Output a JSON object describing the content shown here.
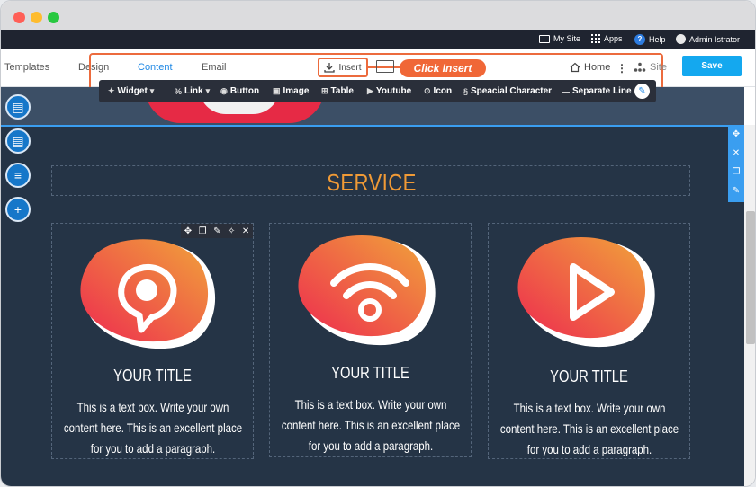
{
  "admin_bar": {
    "my_site": "My Site",
    "apps": "Apps",
    "help": "Help",
    "user": "Admin Istrator"
  },
  "nav": {
    "tabs": [
      "Templates",
      "Design",
      "Content",
      "Email"
    ],
    "active_tab": "Content",
    "insert": "Insert",
    "callout": "Click Insert",
    "home": "Home",
    "site": "Site",
    "save": "Save"
  },
  "insert_bar": {
    "widget": "Widget",
    "link": "Link",
    "button": "Button",
    "image": "Image",
    "table": "Table",
    "youtube": "Youtube",
    "icon": "Icon",
    "special_character": "Speacial Character",
    "separate_line": "Separate Line"
  },
  "section": {
    "title": "SERVICE",
    "cards": [
      {
        "icon": "location-pin-icon",
        "title": "YOUR TITLE",
        "lines": [
          "This is a text box. Write your own",
          "content here. This is an excellent place",
          "for you to add a paragraph."
        ]
      },
      {
        "icon": "wifi-icon",
        "title": "YOUR TITLE",
        "lines": [
          "This is a text box. Write your own",
          "content here. This is an excellent place",
          "for you to add a paragraph."
        ]
      },
      {
        "icon": "play-icon",
        "title": "YOUR TITLE",
        "lines": [
          "This is a text box. Write your own",
          "content here. This is an excellent place",
          "for you to add a paragraph."
        ]
      }
    ]
  },
  "colors": {
    "accent": "#ec6b3d",
    "save": "#14a8ef",
    "canvas": "#253446",
    "service_title": "#f09a36",
    "gradient_start": "#ee2b4f",
    "gradient_end": "#f0a33a"
  }
}
